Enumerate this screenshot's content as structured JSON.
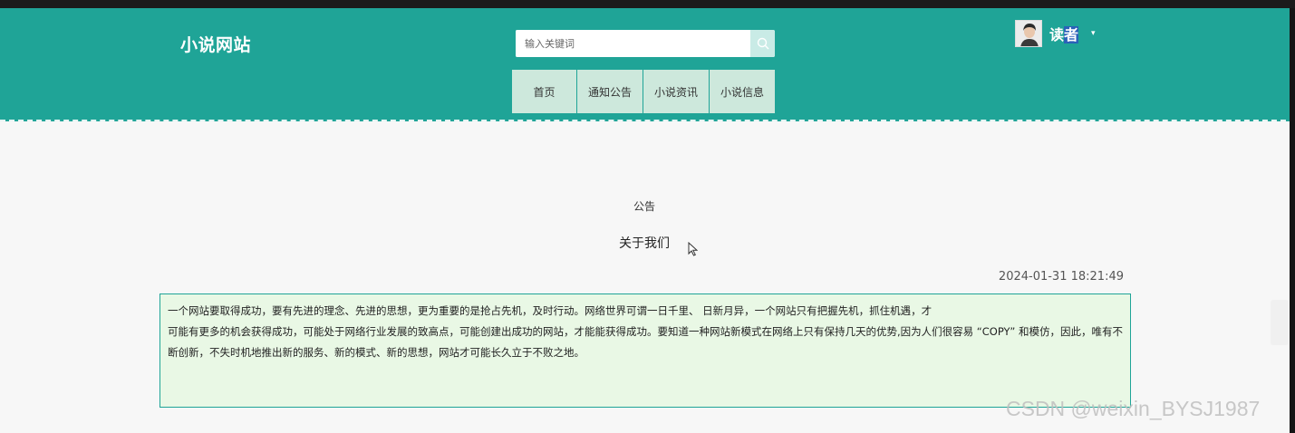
{
  "site": {
    "logo": "小说网站"
  },
  "search": {
    "placeholder": "输入关键词"
  },
  "nav": {
    "items": [
      {
        "label": "首页"
      },
      {
        "label": "通知公告"
      },
      {
        "label": "小说资讯"
      },
      {
        "label": "小说信息"
      }
    ]
  },
  "user": {
    "name_part1": "读",
    "name_part2": "者"
  },
  "article": {
    "category": "公告",
    "title": "关于我们",
    "date": "2024-01-31 18:21:49",
    "paragraphs": [
      "一个网站要取得成功，要有先进的理念、先进的思想，更为重要的是抢占先机，及时行动。网络世界可谓一日千里、 日新月异，一个网站只有把握先机，抓住机遇，才",
      "可能有更多的机会获得成功，可能处于网络行业发展的致高点，可能创建出成功的网站，才能能获得成功。要知道一种网站新模式在网络上只有保持几天的优势,因为人们很容易 “COPY” 和模仿，因此，唯有不",
      "断创新，不失时机地推出新的服务、新的模式、新的思想，网站才可能长久立于不败之地。"
    ]
  },
  "watermark": "CSDN @weixin_BYSJ1987",
  "colors": {
    "header": "#1fa497",
    "nav_bg": "#cde8dc",
    "content_bg": "#e9f8e5"
  }
}
